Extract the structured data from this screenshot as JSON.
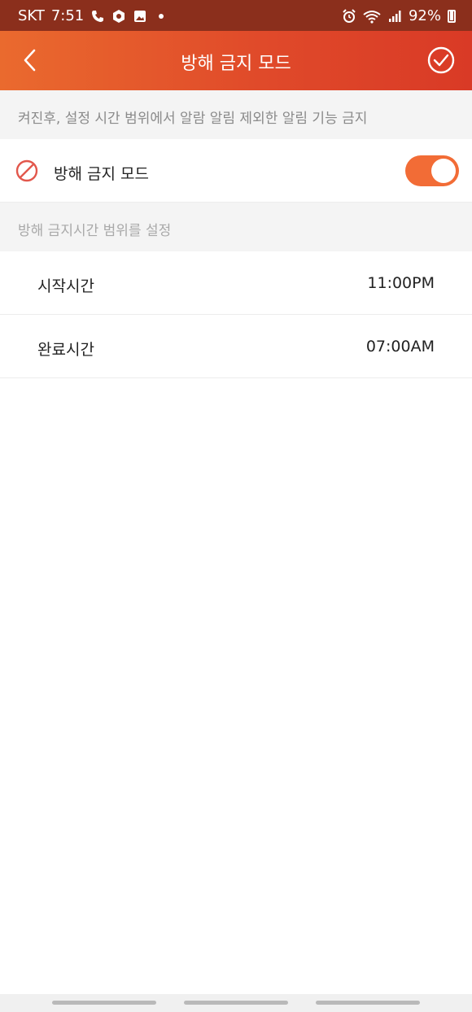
{
  "status_bar": {
    "carrier": "SKT",
    "time": "7:51",
    "battery": "92%"
  },
  "header": {
    "title": "방해 금지 모드",
    "back_icon": "chevron-left-icon",
    "confirm_icon": "check-circle-icon"
  },
  "notice": {
    "text": "켜진후, 설정 시간 범위에서 알람 알림 제외한 알림 기능 금지"
  },
  "dnd_toggle": {
    "label": "방해 금지 모드",
    "enabled": true,
    "icon": "do-not-disturb-icon"
  },
  "section": {
    "title": "방해 금지시간 범위를 설정"
  },
  "times": [
    {
      "label": "시작시간",
      "value": "11:00PM"
    },
    {
      "label": "완료시간",
      "value": "07:00AM"
    }
  ],
  "colors": {
    "accent": "#f26c36",
    "header_start": "#ea6a2e",
    "header_end": "#d93a26"
  }
}
